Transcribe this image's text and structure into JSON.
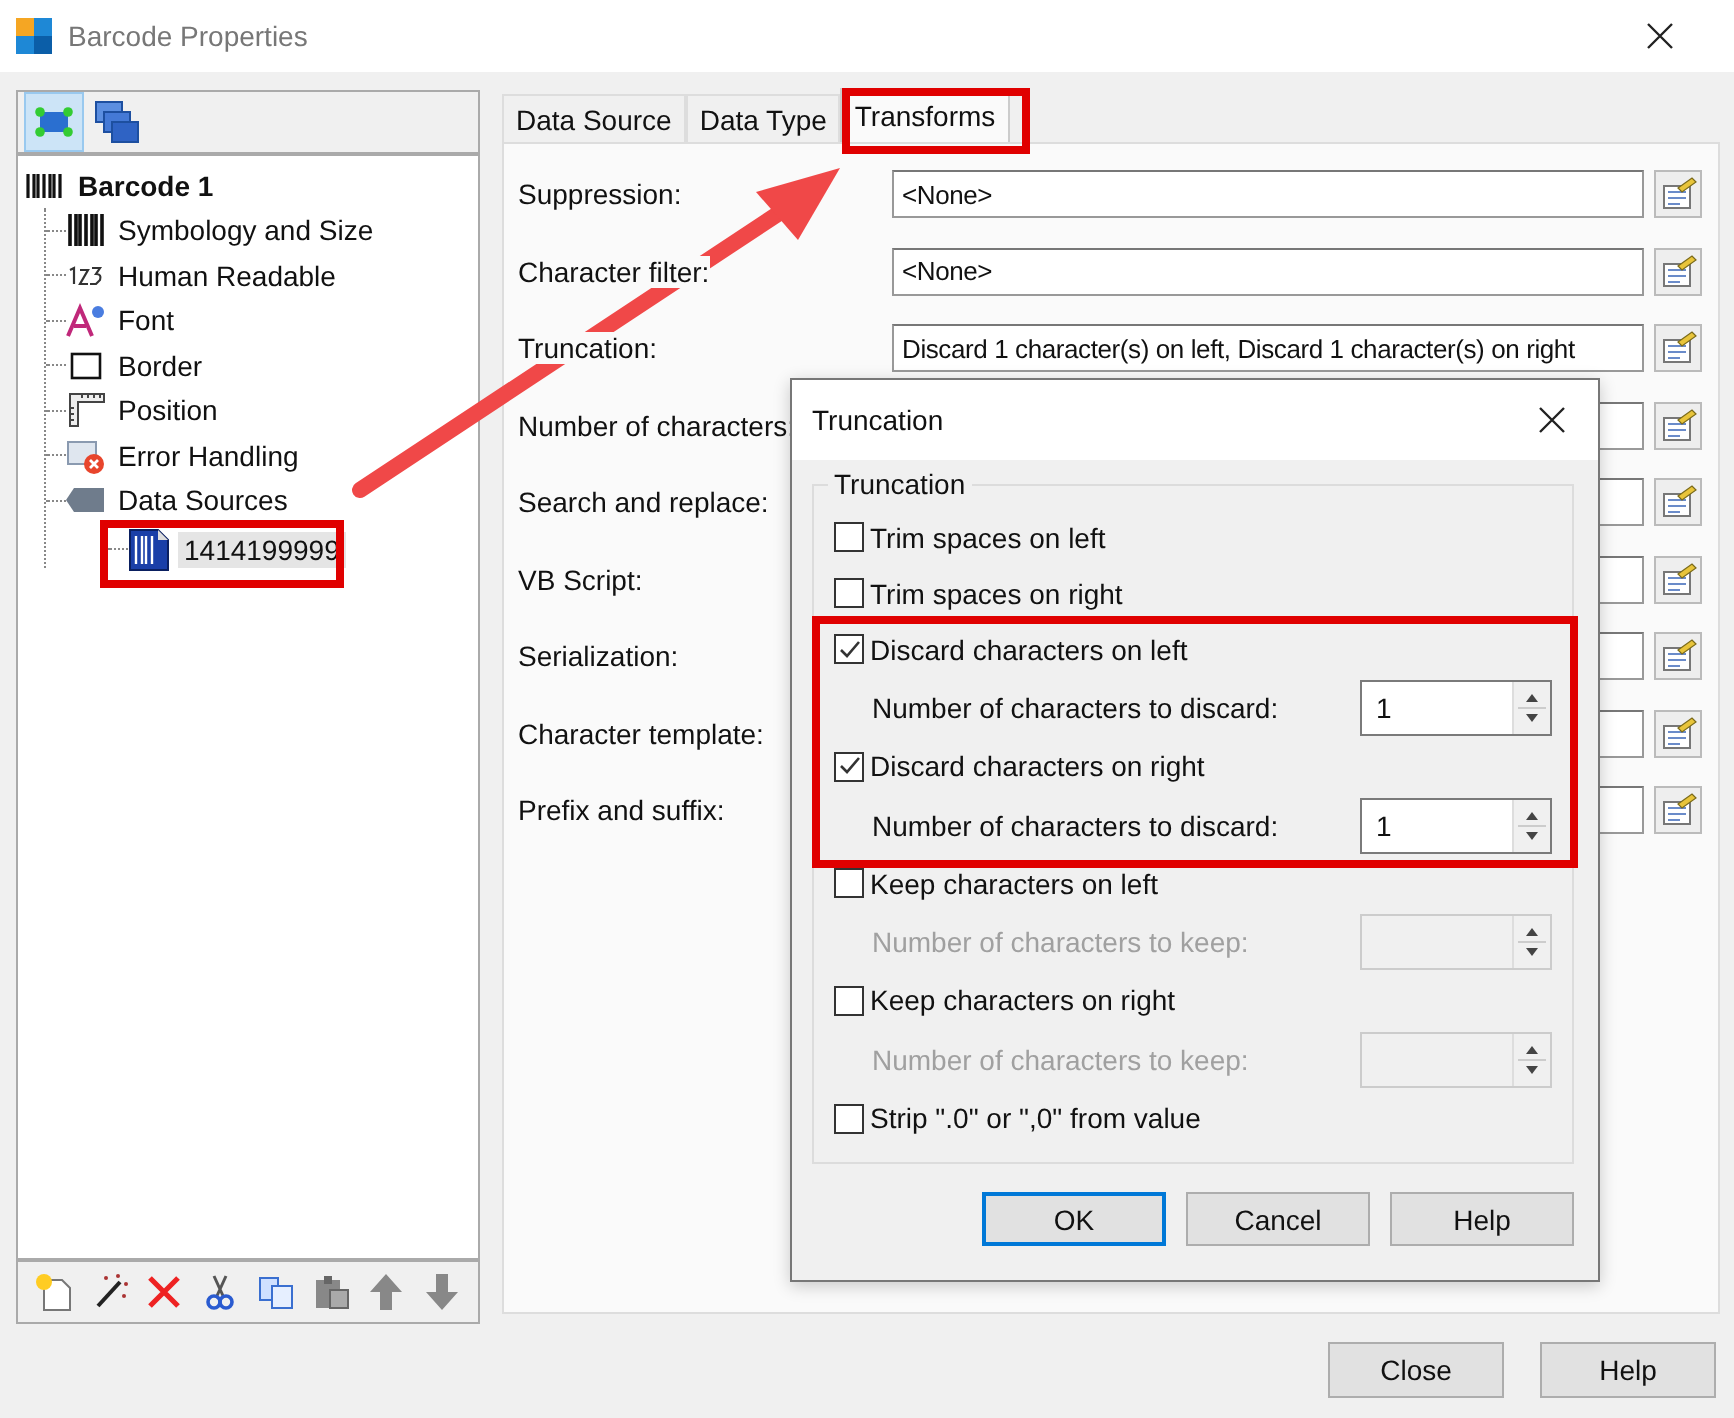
{
  "window": {
    "title": "Barcode Properties"
  },
  "tree": {
    "label": "Barcode 1",
    "selected": false,
    "children": [
      {
        "label": "Symbology and Size",
        "selected": false
      },
      {
        "label": "Human Readable",
        "selected": false
      },
      {
        "label": "Font",
        "selected": false
      },
      {
        "label": "Border",
        "selected": false
      },
      {
        "label": "Position",
        "selected": false
      },
      {
        "label": "Error Handling",
        "selected": false
      },
      {
        "label": "Data Sources",
        "selected": false,
        "children": [
          {
            "label": "1414199999",
            "selected": true
          }
        ]
      }
    ]
  },
  "tabs": [
    {
      "label": "Data Source",
      "selected": false
    },
    {
      "label": "Data Type",
      "selected": false
    },
    {
      "label": "Transforms",
      "selected": true
    }
  ],
  "form": [
    {
      "label": "Suppression:",
      "value": "<None>"
    },
    {
      "label": "Character filter:",
      "value": "<None>"
    },
    {
      "label": "Truncation:",
      "value": "Discard 1 character(s) on left, Discard 1 character(s) on right"
    },
    {
      "label": "Number of characters:"
    },
    {
      "label": "Search and replace:"
    },
    {
      "label": "VB Script:"
    },
    {
      "label": "Serialization:"
    },
    {
      "label": "Character template:"
    },
    {
      "label": "Prefix and suffix:"
    }
  ],
  "dialog": {
    "title": "Truncation",
    "group": "Truncation",
    "options": [
      {
        "kind": "checkbox",
        "label": "Trim spaces on left",
        "checked": false
      },
      {
        "kind": "checkbox",
        "label": "Trim spaces on right",
        "checked": false
      },
      {
        "kind": "checkbox",
        "label": "Discard characters on left",
        "checked": true
      },
      {
        "kind": "spin",
        "label": "Number of characters to discard:",
        "value": "1",
        "disabled": false
      },
      {
        "kind": "checkbox",
        "label": "Discard characters on right",
        "checked": true
      },
      {
        "kind": "spin",
        "label": "Number of characters to discard:",
        "value": "1",
        "disabled": false
      },
      {
        "kind": "checkbox",
        "label": "Keep characters on left",
        "checked": false
      },
      {
        "kind": "spin",
        "label": "Number of characters to keep:",
        "disabled": true
      },
      {
        "kind": "checkbox",
        "label": "Keep characters on right",
        "checked": false
      },
      {
        "kind": "spin",
        "label": "Number of characters to keep:",
        "disabled": true
      },
      {
        "kind": "checkbox",
        "label": "Strip \".0\" or \",0\" from value",
        "checked": false
      }
    ],
    "buttons": [
      {
        "label": "OK",
        "default": true
      },
      {
        "label": "Cancel",
        "default": false
      },
      {
        "label": "Help",
        "default": false
      }
    ]
  },
  "footer_buttons": [
    "Close",
    "Help"
  ]
}
